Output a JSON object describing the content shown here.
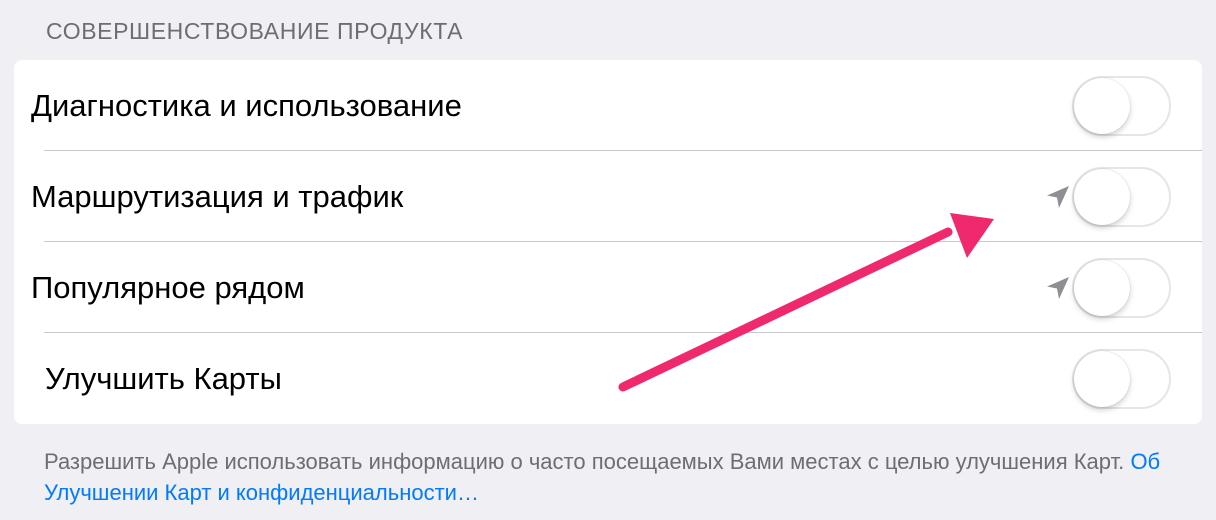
{
  "section": {
    "title": "СОВЕРШЕНСТВОВАНИЕ ПРОДУКТА"
  },
  "rows": [
    {
      "label": "Диагностика и использование",
      "enabled": false,
      "location_icon": false
    },
    {
      "label": "Маршрутизация и трафик",
      "enabled": false,
      "location_icon": true
    },
    {
      "label": "Популярное рядом",
      "enabled": false,
      "location_icon": true
    },
    {
      "label": "Улучшить Карты",
      "enabled": false,
      "location_icon": false
    }
  ],
  "footer": {
    "text": "Разрешить Apple использовать информацию о часто посещаемых Вами местах с целью улучшения Карт.",
    "link": "Об Улучшении Карт и конфиденциальности…"
  },
  "icons": {
    "location": "location-arrow-icon",
    "annotation": "pink-annotation-arrow"
  },
  "colors": {
    "background": "#efeff4",
    "accent_link": "#007aff",
    "annotation_arrow": "#f0286e",
    "toggle_off_border": "#e5e5ea",
    "secondary_text": "#6d6d72"
  }
}
